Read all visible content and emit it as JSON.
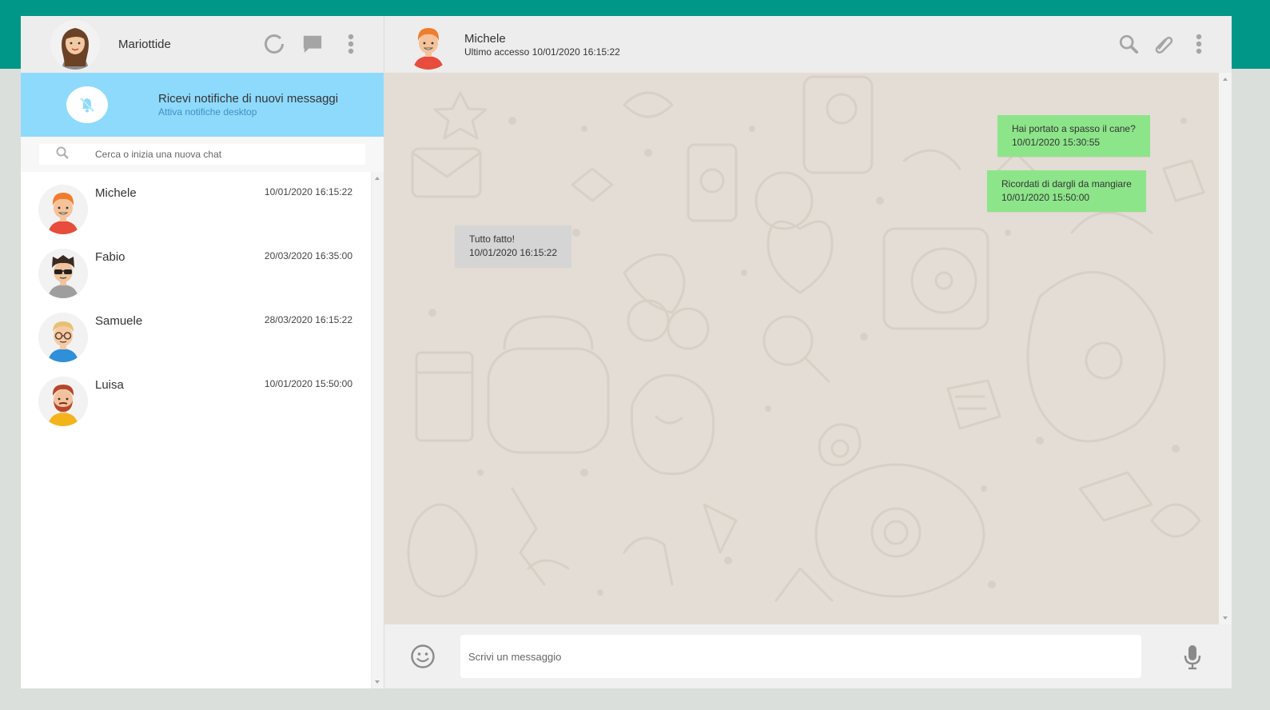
{
  "user": {
    "name": "Mariottide",
    "avatar": "woman-avatar"
  },
  "left_header_icons": [
    "status-icon",
    "chat-bubble-icon",
    "menu-dots-icon"
  ],
  "notification": {
    "title": "Ricevi notifiche di nuovi messaggi",
    "subtitle": "Attiva notifiche desktop",
    "icon": "bell-off-icon"
  },
  "search": {
    "placeholder": "Cerca o inizia una nuova chat"
  },
  "contacts": [
    {
      "name": "Michele",
      "time": "10/01/2020 16:15:22",
      "avatar": "orange-hair-avatar"
    },
    {
      "name": "Fabio",
      "time": "20/03/2020 16:35:00",
      "avatar": "sunglasses-avatar"
    },
    {
      "name": "Samuele",
      "time": "28/03/2020 16:15:22",
      "avatar": "glasses-avatar"
    },
    {
      "name": "Luisa",
      "time": "10/01/2020 15:50:00",
      "avatar": "beard-avatar"
    }
  ],
  "chat": {
    "name": "Michele",
    "last_access": "Ultimo accesso 10/01/2020 16:15:22",
    "header_icons": [
      "search-icon",
      "paperclip-icon",
      "menu-dots-icon"
    ],
    "messages": [
      {
        "type": "sent",
        "text": "Hai portato a spasso il cane?",
        "time": "10/01/2020 15:30:55"
      },
      {
        "type": "sent",
        "text": "Ricordati di dargli da mangiare",
        "time": "10/01/2020 15:50:00"
      },
      {
        "type": "received",
        "text": "Tutto fatto!",
        "time": "10/01/2020 16:15:22"
      }
    ]
  },
  "composer": {
    "placeholder": "Scrivi un messaggio",
    "emoji_icon": "smiley-icon",
    "mic_icon": "microphone-icon"
  },
  "colors": {
    "teal": "#009688",
    "notification_bg": "#8edafc",
    "sent_bubble": "#8de58a",
    "received_bubble": "#d5d5d5",
    "chat_bg": "#e4ddd5"
  }
}
